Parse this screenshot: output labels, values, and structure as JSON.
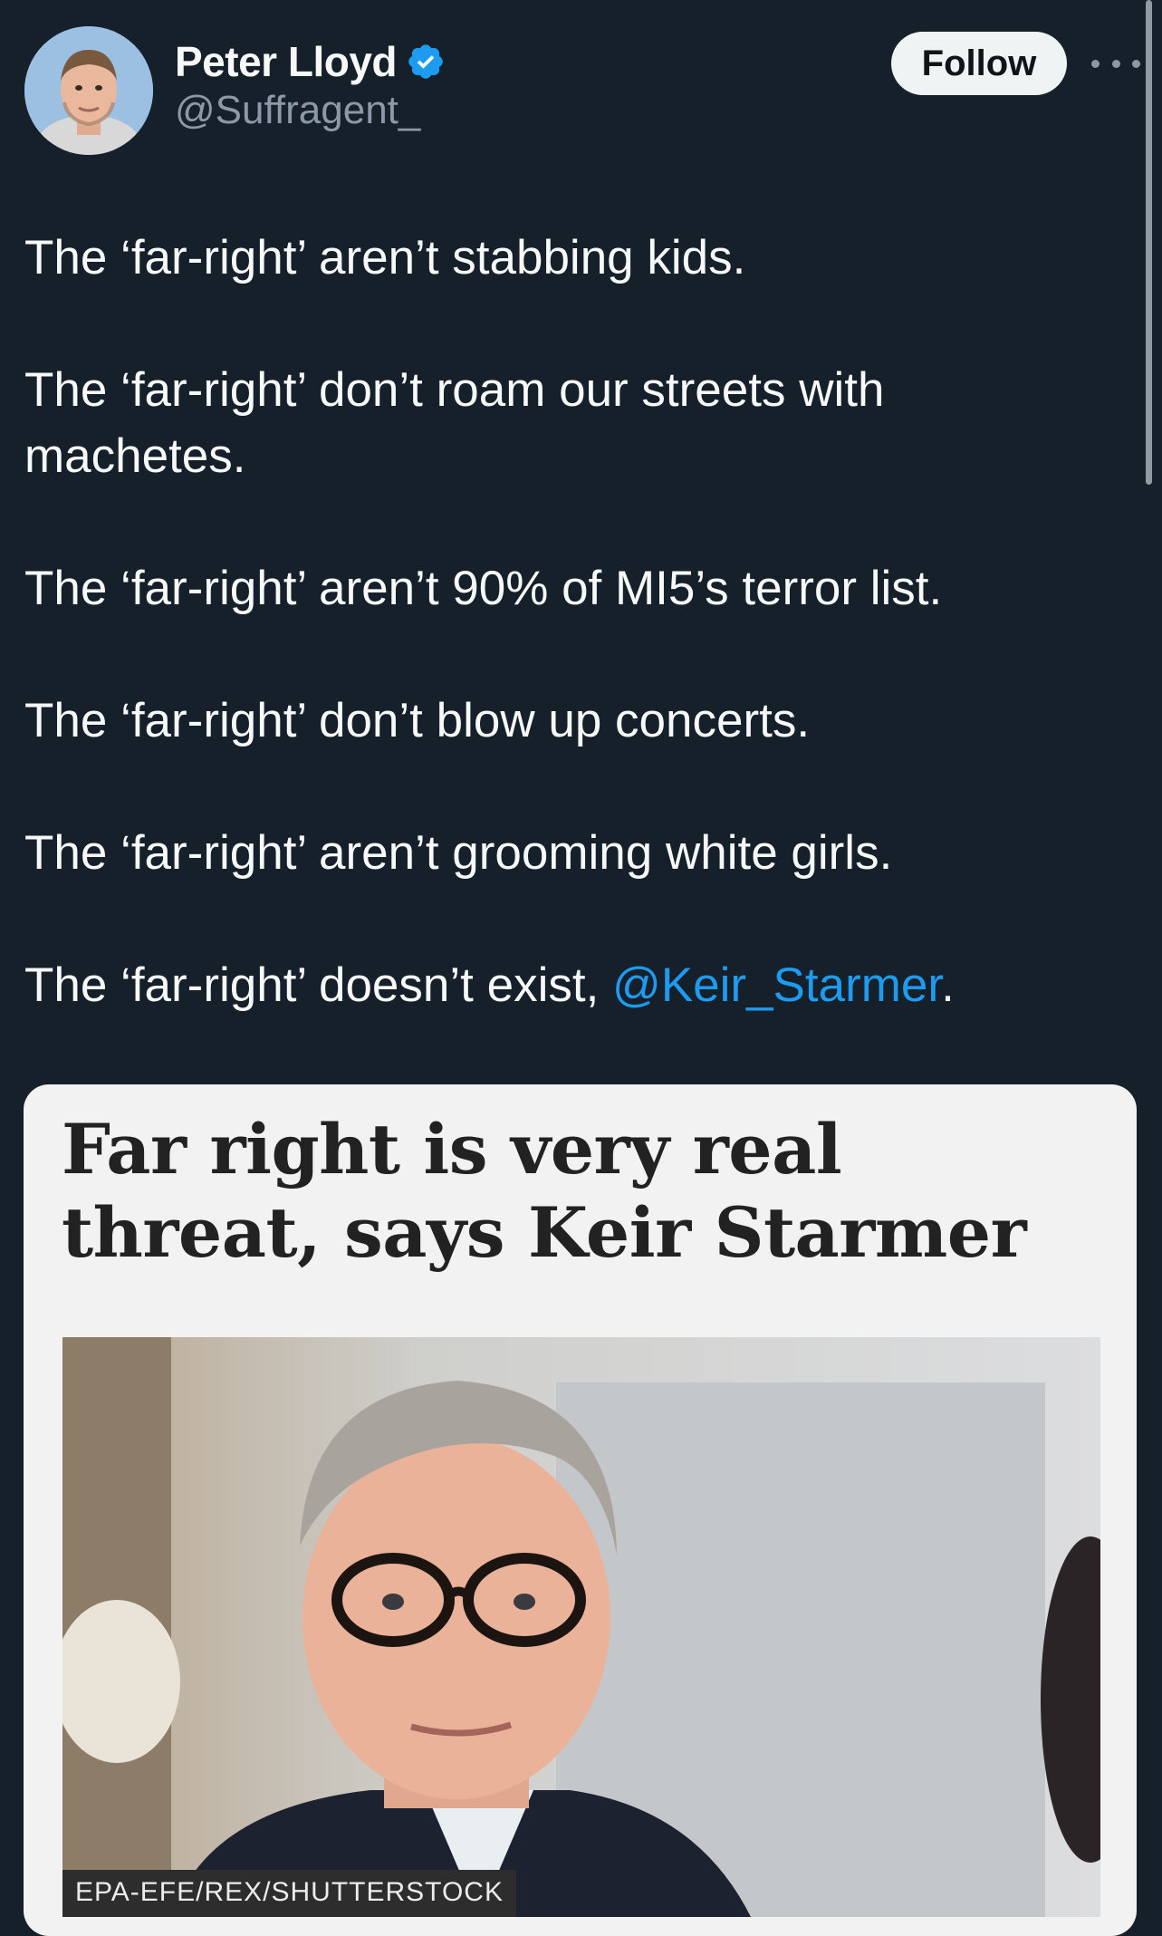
{
  "author": {
    "display_name": "Peter Lloyd",
    "handle": "@Suffragent_",
    "verified": true
  },
  "actions": {
    "follow_label": "Follow",
    "more_icon": "more-horizontal-icon"
  },
  "tweet": {
    "lines": [
      "The ‘far-right’ aren’t stabbing kids.",
      "The ‘far-right’ don’t roam our streets with machetes.",
      "The ‘far-right’ aren’t 90% of MI5’s terror list.",
      "The ‘far-right’ don’t blow up concerts.",
      "The ‘far-right’ aren’t grooming white girls."
    ],
    "last_line_prefix": "The ‘far-right’ doesn’t exist, ",
    "last_line_mention": "@Keir_Starmer",
    "last_line_suffix": "."
  },
  "media": {
    "headline": "Far right is very real threat, says Keir Starmer",
    "photo_credit": "EPA-EFE/REX/SHUTTERSTOCK"
  },
  "colors": {
    "background": "#15202b",
    "text": "#f7f9f9",
    "secondary_text": "#8b98a5",
    "link": "#1d9bf0",
    "verified_badge": "#1d9bf0"
  }
}
